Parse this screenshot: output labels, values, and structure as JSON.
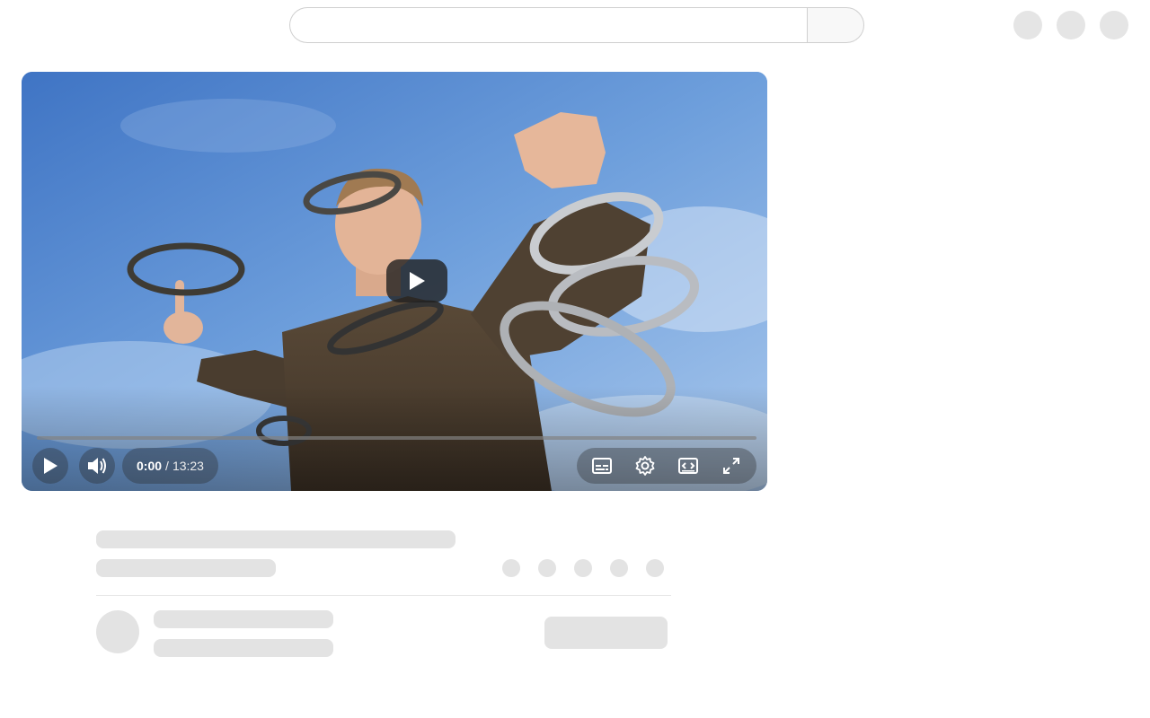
{
  "search": {
    "placeholder": ""
  },
  "player": {
    "current_time": "0:00",
    "separator": "/",
    "duration": "13:23",
    "progress": 0.0
  },
  "icons": {
    "big_play": "play-icon",
    "play": "play-icon",
    "volume": "volume-icon",
    "captions": "captions-icon",
    "settings": "gear-icon",
    "theater": "theater-mode-icon",
    "fullscreen": "fullscreen-icon"
  }
}
